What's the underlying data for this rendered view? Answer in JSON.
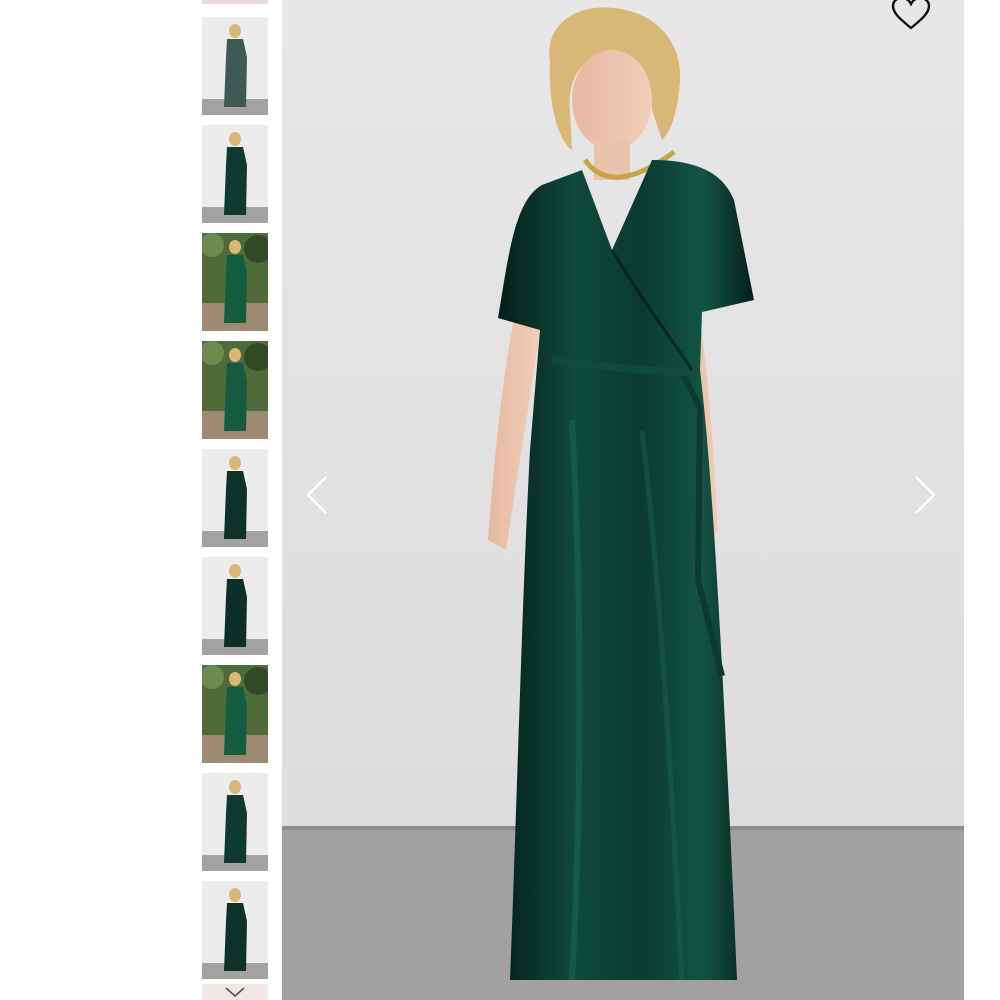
{
  "gallery": {
    "thumbnails": [
      {
        "name": "thumb-1",
        "scene": "studio",
        "dress": "#3f5a55"
      },
      {
        "name": "thumb-2",
        "scene": "studio",
        "dress": "#0f3a30"
      },
      {
        "name": "thumb-3",
        "scene": "garden",
        "dress": "#145c3e"
      },
      {
        "name": "thumb-4",
        "scene": "garden",
        "dress": "#165a40"
      },
      {
        "name": "thumb-5",
        "scene": "studio",
        "dress": "#0e3229"
      },
      {
        "name": "thumb-6",
        "scene": "studio",
        "dress": "#0d2f28"
      },
      {
        "name": "thumb-7",
        "scene": "garden",
        "dress": "#165c40"
      },
      {
        "name": "thumb-8",
        "scene": "studio",
        "dress": "#0f3a30"
      },
      {
        "name": "thumb-9",
        "scene": "studio",
        "dress": "#0e3229"
      }
    ],
    "scroll_down_icon": "chevron-down-icon"
  },
  "main_image": {
    "dress_color": "#0b3a30",
    "wall_color": "#e4e3e4",
    "floor_color": "#a2a09e",
    "prev_icon": "chevron-left-icon",
    "next_icon": "chevron-right-icon",
    "wishlist_icon": "heart-icon"
  }
}
